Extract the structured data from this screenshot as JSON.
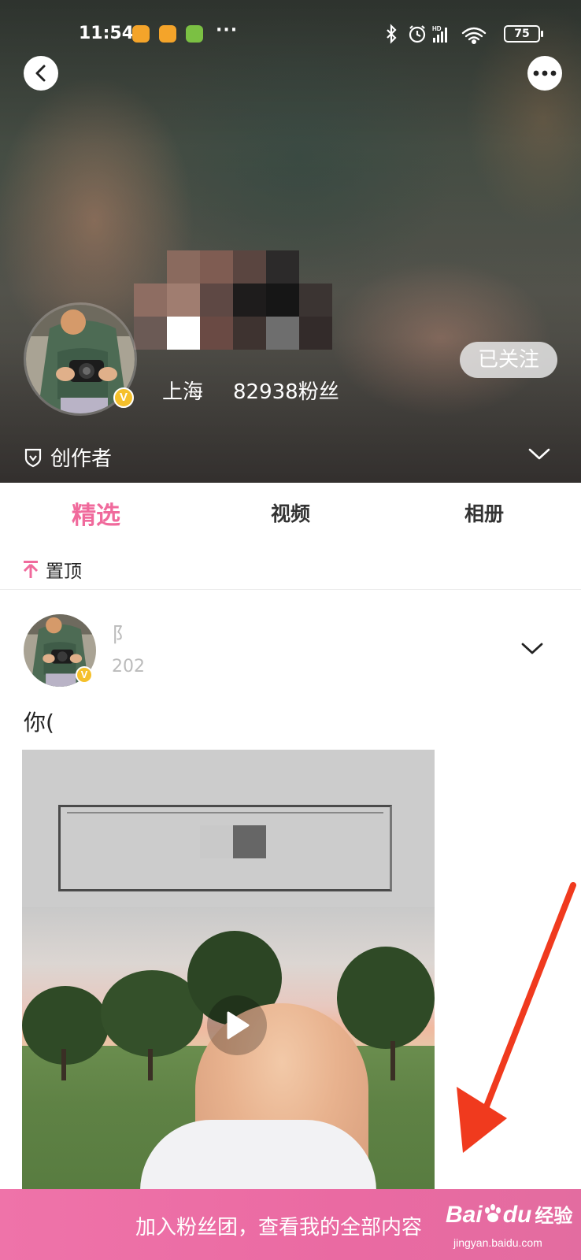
{
  "status_bar": {
    "time": "11:54",
    "dots": "···",
    "battery": "75",
    "network": "HD"
  },
  "profile": {
    "location": "上海",
    "fans": "82938粉丝",
    "follow_label": "已关注",
    "creator_label": "创作者",
    "badge": "V"
  },
  "tabs": [
    {
      "label": "精选",
      "active": true
    },
    {
      "label": "视频",
      "active": false
    },
    {
      "label": "相册",
      "active": false
    }
  ],
  "pinned": {
    "label": "置顶"
  },
  "post": {
    "author_partial": "阝",
    "date_partial": "202",
    "text_partial": "你(",
    "badge": "V"
  },
  "banner": {
    "text": "加入粉丝团，查看我的全部内容",
    "watermark_main": "Bai",
    "watermark_du": "du",
    "watermark_cn": "经验",
    "watermark_sub": "jingyan.baidu.com"
  },
  "colors": {
    "accent": "#f06a9c",
    "banner": "#ec6ea6",
    "badge": "#f5c02b",
    "arrow": "#f03a1e"
  }
}
